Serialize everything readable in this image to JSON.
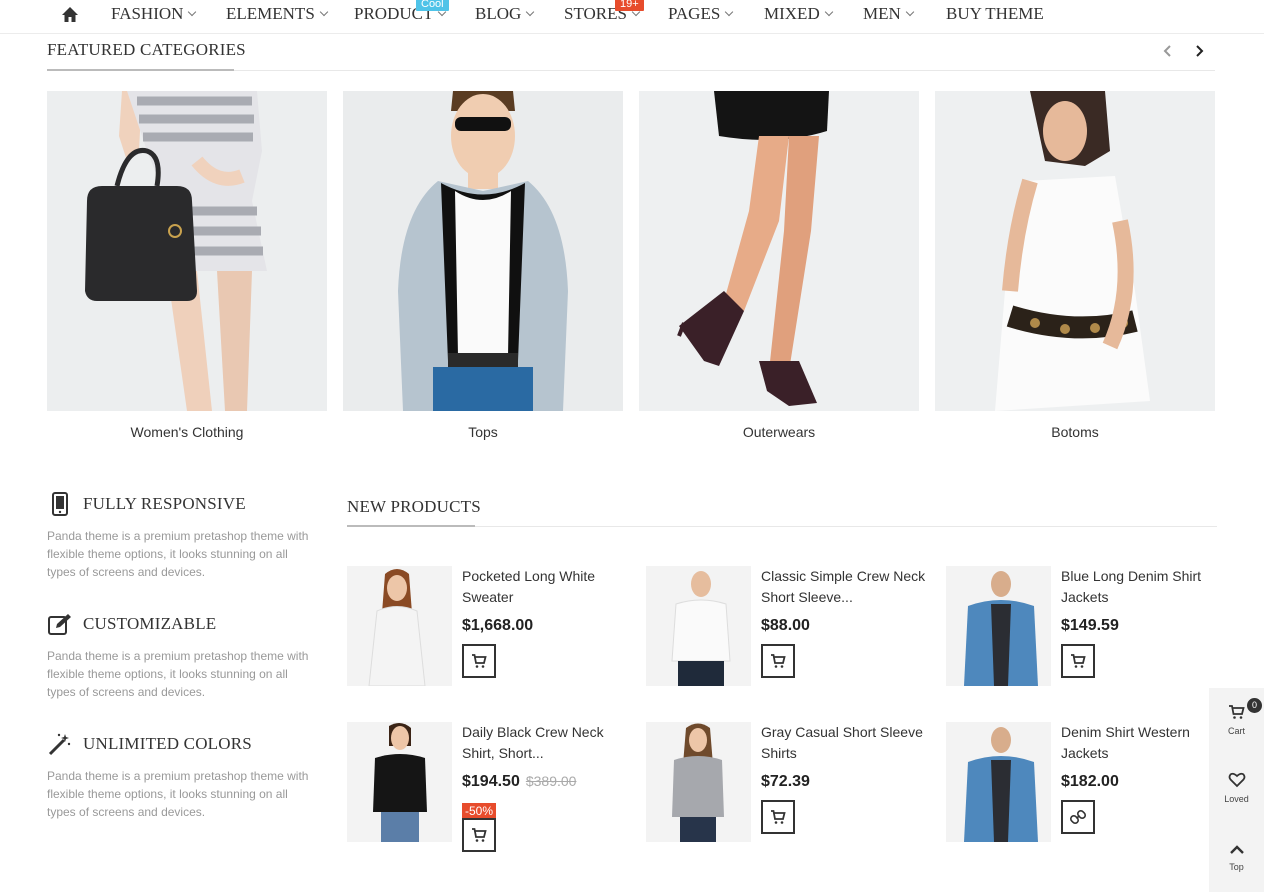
{
  "nav": {
    "items": [
      {
        "label": "FASHION",
        "chevron": true
      },
      {
        "label": "ELEMENTS",
        "chevron": true
      },
      {
        "label": "PRODUCT",
        "chevron": true,
        "badge": "Cool"
      },
      {
        "label": "BLOG",
        "chevron": true
      },
      {
        "label": "STORES",
        "chevron": true,
        "badge": "19+"
      },
      {
        "label": "PAGES",
        "chevron": true
      },
      {
        "label": "MIXED",
        "chevron": true
      },
      {
        "label": "MEN",
        "chevron": true
      },
      {
        "label": "BUY THEME",
        "chevron": false
      }
    ]
  },
  "featured": {
    "title": "FEATURED CATEGORIES",
    "categories": [
      {
        "label": "Women's Clothing"
      },
      {
        "label": "Tops"
      },
      {
        "label": "Outerwears"
      },
      {
        "label": "Botoms"
      }
    ]
  },
  "features": [
    {
      "title": "FULLY RESPONSIVE",
      "icon": "mobile-phone-icon",
      "desc": "Panda theme is a premium pretashop theme with flexible theme options, it looks stunning on all types of screens and devices."
    },
    {
      "title": "CUSTOMIZABLE",
      "icon": "edit-icon",
      "desc": "Panda theme is a premium pretashop theme with flexible theme options, it looks stunning on all types of screens and devices."
    },
    {
      "title": "UNLIMITED COLORS",
      "icon": "magic-wand-icon",
      "desc": "Panda theme is a premium pretashop theme with flexible theme options, it looks stunning on all types of screens and devices."
    }
  ],
  "new_products": {
    "title": "NEW PRODUCTS",
    "items": [
      {
        "name": "Pocketed Long White Sweater",
        "price": "$1,668.00",
        "button_icon": "cart-icon"
      },
      {
        "name": "Classic Simple Crew Neck Short Sleeve...",
        "price": "$88.00",
        "button_icon": "cart-icon"
      },
      {
        "name": "Blue Long Denim Shirt Jackets",
        "price": "$149.59",
        "button_icon": "cart-icon"
      },
      {
        "name": "Daily Black Crew Neck Shirt, Short...",
        "price": "$194.50",
        "old_price": "$389.00",
        "discount": "-50%",
        "button_icon": "cart-icon"
      },
      {
        "name": "Gray Casual Short Sleeve Shirts",
        "price": "$72.39",
        "button_icon": "cart-icon"
      },
      {
        "name": "Denim Shirt Western Jackets",
        "price": "$182.00",
        "button_icon": "link-icon"
      }
    ]
  },
  "sidebar": {
    "cart_label": "Cart",
    "cart_count": "0",
    "loved_label": "Loved",
    "top_label": "Top"
  },
  "colors": {
    "badge_blue": "#4fc3e8",
    "badge_red": "#e74c2c",
    "text": "#333333",
    "muted": "#999999"
  }
}
